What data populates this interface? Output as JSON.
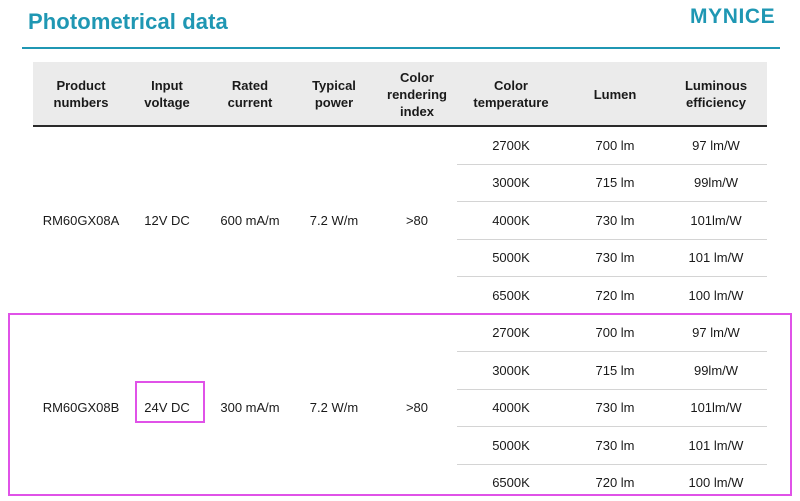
{
  "header": {
    "title": "Photometrical data",
    "brand": "MYNICE"
  },
  "colors": {
    "accent": "#1f97b3",
    "highlight": "#e052e8",
    "header_bg": "#ebebeb"
  },
  "table": {
    "columns": [
      "Product\nnumbers",
      "Input\nvoltage",
      "Rated\ncurrent",
      "Typical\npower",
      "Color\nrendering\nindex",
      "Color\ntemperature",
      "Lumen",
      "Luminous\nefficiency"
    ],
    "groups": [
      {
        "product": "RM60GX08A",
        "voltage": "12V DC",
        "current": "600 mA/m",
        "power": "7.2 W/m",
        "cri": ">80",
        "rows": [
          {
            "temp": "2700K",
            "lumen": "700 lm",
            "efficiency": "97 lm/W"
          },
          {
            "temp": "3000K",
            "lumen": "715 lm",
            "efficiency": "99lm/W"
          },
          {
            "temp": "4000K",
            "lumen": "730 lm",
            "efficiency": "101lm/W"
          },
          {
            "temp": "5000K",
            "lumen": "730 lm",
            "efficiency": "101 lm/W"
          },
          {
            "temp": "6500K",
            "lumen": "720 lm",
            "efficiency": "100 lm/W"
          }
        ]
      },
      {
        "product": "RM60GX08B",
        "voltage": "24V DC",
        "current": "300 mA/m",
        "power": "7.2 W/m",
        "cri": ">80",
        "rows": [
          {
            "temp": "2700K",
            "lumen": "700 lm",
            "efficiency": "97 lm/W"
          },
          {
            "temp": "3000K",
            "lumen": "715 lm",
            "efficiency": "99lm/W"
          },
          {
            "temp": "4000K",
            "lumen": "730 lm",
            "efficiency": "101lm/W"
          },
          {
            "temp": "5000K",
            "lumen": "730 lm",
            "efficiency": "101 lm/W"
          },
          {
            "temp": "6500K",
            "lumen": "720 lm",
            "efficiency": "100 lm/W"
          }
        ]
      }
    ]
  }
}
